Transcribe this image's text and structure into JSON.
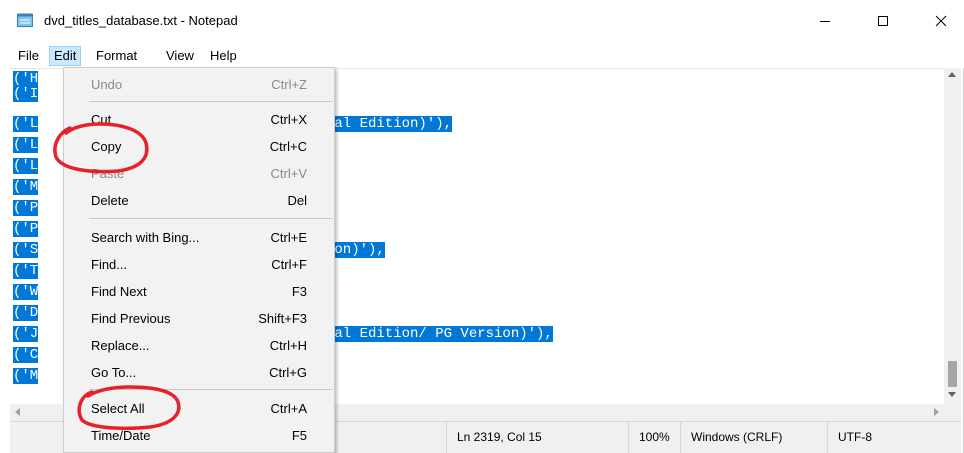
{
  "window": {
    "title": "dvd_titles_database.txt - Notepad"
  },
  "menubar": {
    "file": "File",
    "edit": "Edit",
    "format": "Format",
    "view": "View",
    "help": "Help"
  },
  "editor": {
    "lines": [
      {
        "text": "('H"
      },
      {
        "text": "('I"
      },
      {
        "text": "('L",
        "tail": "ial Edition)'),"
      },
      {
        "text": "('L"
      },
      {
        "text": "('L"
      },
      {
        "text": "('M",
        "tail": ","
      },
      {
        "text": "('P"
      },
      {
        "text": "('P"
      },
      {
        "text": "('S",
        "tail": "ion)'),"
      },
      {
        "text": "('T"
      },
      {
        "text": "('W",
        "tail": ","
      },
      {
        "text": "('D"
      },
      {
        "text": "('J",
        "tail": "ial Edition/ PG Version)'),"
      },
      {
        "text": "('C"
      },
      {
        "text": "('M"
      }
    ]
  },
  "edit_menu": {
    "undo": {
      "label": "Undo",
      "shortcut": "Ctrl+Z"
    },
    "cut": {
      "label": "Cut",
      "shortcut": "Ctrl+X"
    },
    "copy": {
      "label": "Copy",
      "shortcut": "Ctrl+C"
    },
    "paste": {
      "label": "Paste",
      "shortcut": "Ctrl+V"
    },
    "delete": {
      "label": "Delete",
      "shortcut": "Del"
    },
    "search_bing": {
      "label": "Search with Bing...",
      "shortcut": "Ctrl+E"
    },
    "find": {
      "label": "Find...",
      "shortcut": "Ctrl+F"
    },
    "find_next": {
      "label": "Find Next",
      "shortcut": "F3"
    },
    "find_previous": {
      "label": "Find Previous",
      "shortcut": "Shift+F3"
    },
    "replace": {
      "label": "Replace...",
      "shortcut": "Ctrl+H"
    },
    "goto": {
      "label": "Go To...",
      "shortcut": "Ctrl+G"
    },
    "select_all": {
      "label": "Select All",
      "shortcut": "Ctrl+A"
    },
    "time_date": {
      "label": "Time/Date",
      "shortcut": "F5"
    }
  },
  "statusbar": {
    "position": "Ln 2319, Col 15",
    "zoom": "100%",
    "line_ending": "Windows (CRLF)",
    "encoding": "UTF-8"
  },
  "colors": {
    "selection": "#0078d7",
    "menu_highlight": "#cce8ff",
    "annotation": "#e8202a"
  },
  "icons": {
    "app": "notepad-icon",
    "minimize": "minimize-icon",
    "maximize": "maximize-icon",
    "close": "close-icon"
  }
}
